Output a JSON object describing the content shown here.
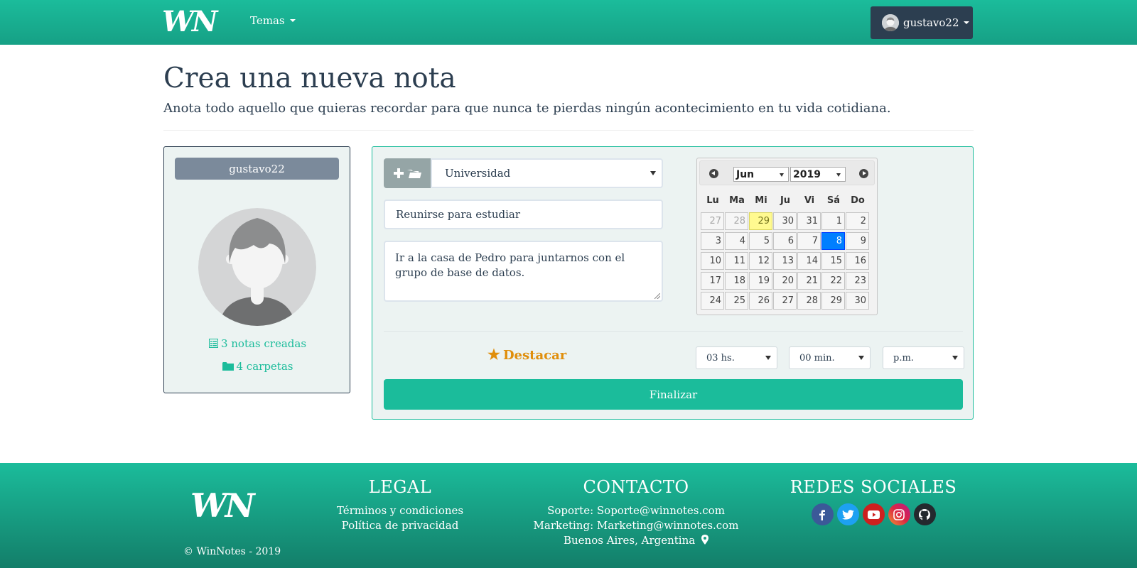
{
  "navbar": {
    "logo_text": "WN",
    "temas_label": "Temas",
    "user_label": "gustavo22"
  },
  "header": {
    "title": "Crea una nueva nota",
    "subtitle": "Anota todo aquello que quieras recordar para que nunca te pierdas ningún acontecimiento en tu vida cotidiana."
  },
  "profile": {
    "username": "gustavo22",
    "notes_link": "3 notas creadas",
    "folders_link": "4 carpetas"
  },
  "form": {
    "folder_value": "Universidad",
    "title_value": "Reunirse para estudiar",
    "description_value": "Ir a la casa de Pedro para juntarnos con el grupo de base de datos.",
    "destacar_label": "Destacar",
    "hours_value": "03 hs.",
    "minutes_value": "00 min.",
    "ampm_value": "p.m.",
    "submit_label": "Finalizar"
  },
  "calendar": {
    "month": "Jun",
    "year": "2019",
    "weekdays": [
      "Lu",
      "Ma",
      "Mi",
      "Ju",
      "Vi",
      "Sá",
      "Do"
    ],
    "weeks": [
      [
        {
          "d": "27",
          "t": "other"
        },
        {
          "d": "28",
          "t": "other"
        },
        {
          "d": "29",
          "t": "today"
        },
        {
          "d": "30",
          "t": "prev"
        },
        {
          "d": "31",
          "t": "prev"
        },
        {
          "d": "1",
          "t": ""
        },
        {
          "d": "2",
          "t": ""
        }
      ],
      [
        {
          "d": "3",
          "t": ""
        },
        {
          "d": "4",
          "t": ""
        },
        {
          "d": "5",
          "t": ""
        },
        {
          "d": "6",
          "t": ""
        },
        {
          "d": "7",
          "t": ""
        },
        {
          "d": "8",
          "t": "selected"
        },
        {
          "d": "9",
          "t": ""
        }
      ],
      [
        {
          "d": "10",
          "t": ""
        },
        {
          "d": "11",
          "t": ""
        },
        {
          "d": "12",
          "t": ""
        },
        {
          "d": "13",
          "t": ""
        },
        {
          "d": "14",
          "t": ""
        },
        {
          "d": "15",
          "t": ""
        },
        {
          "d": "16",
          "t": ""
        }
      ],
      [
        {
          "d": "17",
          "t": ""
        },
        {
          "d": "18",
          "t": ""
        },
        {
          "d": "19",
          "t": ""
        },
        {
          "d": "20",
          "t": ""
        },
        {
          "d": "21",
          "t": ""
        },
        {
          "d": "22",
          "t": ""
        },
        {
          "d": "23",
          "t": ""
        }
      ],
      [
        {
          "d": "24",
          "t": ""
        },
        {
          "d": "25",
          "t": ""
        },
        {
          "d": "26",
          "t": ""
        },
        {
          "d": "27",
          "t": ""
        },
        {
          "d": "28",
          "t": ""
        },
        {
          "d": "29",
          "t": ""
        },
        {
          "d": "30",
          "t": ""
        }
      ]
    ]
  },
  "footer": {
    "logo_text": "WN",
    "copyright": "© WinNotes - 2019",
    "legal": {
      "heading": "LEGAL",
      "terms": "Términos y condiciones",
      "privacy": "Política de privacidad"
    },
    "contact": {
      "heading": "CONTACTO",
      "support": "Soporte: Soporte@winnotes.com",
      "marketing": "Marketing: Marketing@winnotes.com",
      "location": "Buenos Aires, Argentina"
    },
    "social": {
      "heading": "REDES SOCIALES",
      "networks": [
        {
          "name": "facebook",
          "color": "#3b5998"
        },
        {
          "name": "twitter",
          "color": "#1da1f2"
        },
        {
          "name": "youtube",
          "color": "#cd201f"
        },
        {
          "name": "instagram",
          "color": "#c13584"
        },
        {
          "name": "github",
          "color": "#24292e"
        }
      ]
    }
  },
  "colors": {
    "brand": "#1bbc9b",
    "dark": "#2c3e50",
    "accent": "#e08e0b"
  }
}
